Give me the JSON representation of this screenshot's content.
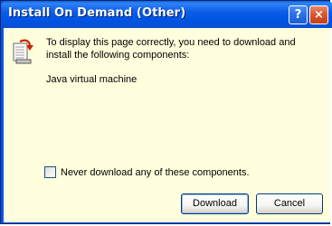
{
  "window": {
    "title": "Install On Demand (Other)",
    "help_label": "?",
    "close_label": "×"
  },
  "dialog": {
    "message": "To display this page correctly, you need to download and install the following components:",
    "components": [
      "Java virtual machine"
    ],
    "checkbox_label": "Never download any of these components.",
    "checkbox_checked": false,
    "download_label": "Download",
    "cancel_label": "Cancel"
  },
  "colors": {
    "title_bar": "#0054e3",
    "client_bg": "#ffffdd",
    "close_button": "#d9532a"
  },
  "icons": {
    "message_icon": "install-document-icon",
    "help": "help-icon",
    "close": "close-icon"
  }
}
